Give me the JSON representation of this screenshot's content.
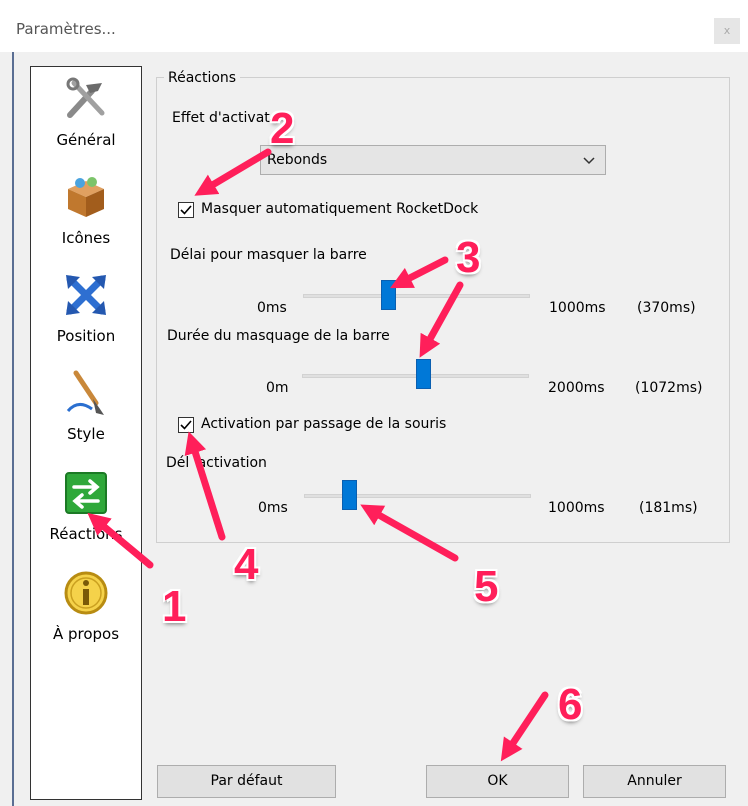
{
  "window": {
    "title": "Paramètres...",
    "close_label": "x"
  },
  "sidebar": {
    "items": [
      {
        "label": "Général",
        "icon": "tools-icon"
      },
      {
        "label": "Icônes",
        "icon": "box-icon"
      },
      {
        "label": "Position",
        "icon": "move-arrows-icon"
      },
      {
        "label": "Style",
        "icon": "brush-icon"
      },
      {
        "label": "Réactions",
        "icon": "swap-arrows-icon"
      },
      {
        "label": "À propos",
        "icon": "info-icon"
      }
    ]
  },
  "reactions": {
    "group_title": "Réactions",
    "activation_effect_label": "Effet d'activat",
    "activation_effect_value": "Rebonds",
    "autohide_label": "Masquer automatiquement RocketDock",
    "autohide_checked": true,
    "hide_delay": {
      "label": "Délai pour masquer la barre",
      "min": "0ms",
      "max": "1000ms",
      "value_text": "(370ms)",
      "value": 370,
      "range": [
        0,
        1000
      ]
    },
    "hide_duration": {
      "label": "Durée du masquage de la barre",
      "min": "0m",
      "max": "2000ms",
      "value_text": "(1072ms)",
      "value": 1072,
      "range": [
        0,
        2000
      ]
    },
    "mouseover_label": "Activation par passage de la souris",
    "mouseover_checked": true,
    "activation_delay": {
      "label": "Dél   'activation",
      "min": "0ms",
      "max": "1000ms",
      "value_text": "(181ms)",
      "value": 181,
      "range": [
        0,
        1000
      ]
    }
  },
  "buttons": {
    "default": "Par défaut",
    "ok": "OK",
    "cancel": "Annuler"
  },
  "annotations": {
    "color": "#ff1f5a",
    "numbers": [
      "1",
      "2",
      "3",
      "4",
      "5",
      "6"
    ]
  }
}
